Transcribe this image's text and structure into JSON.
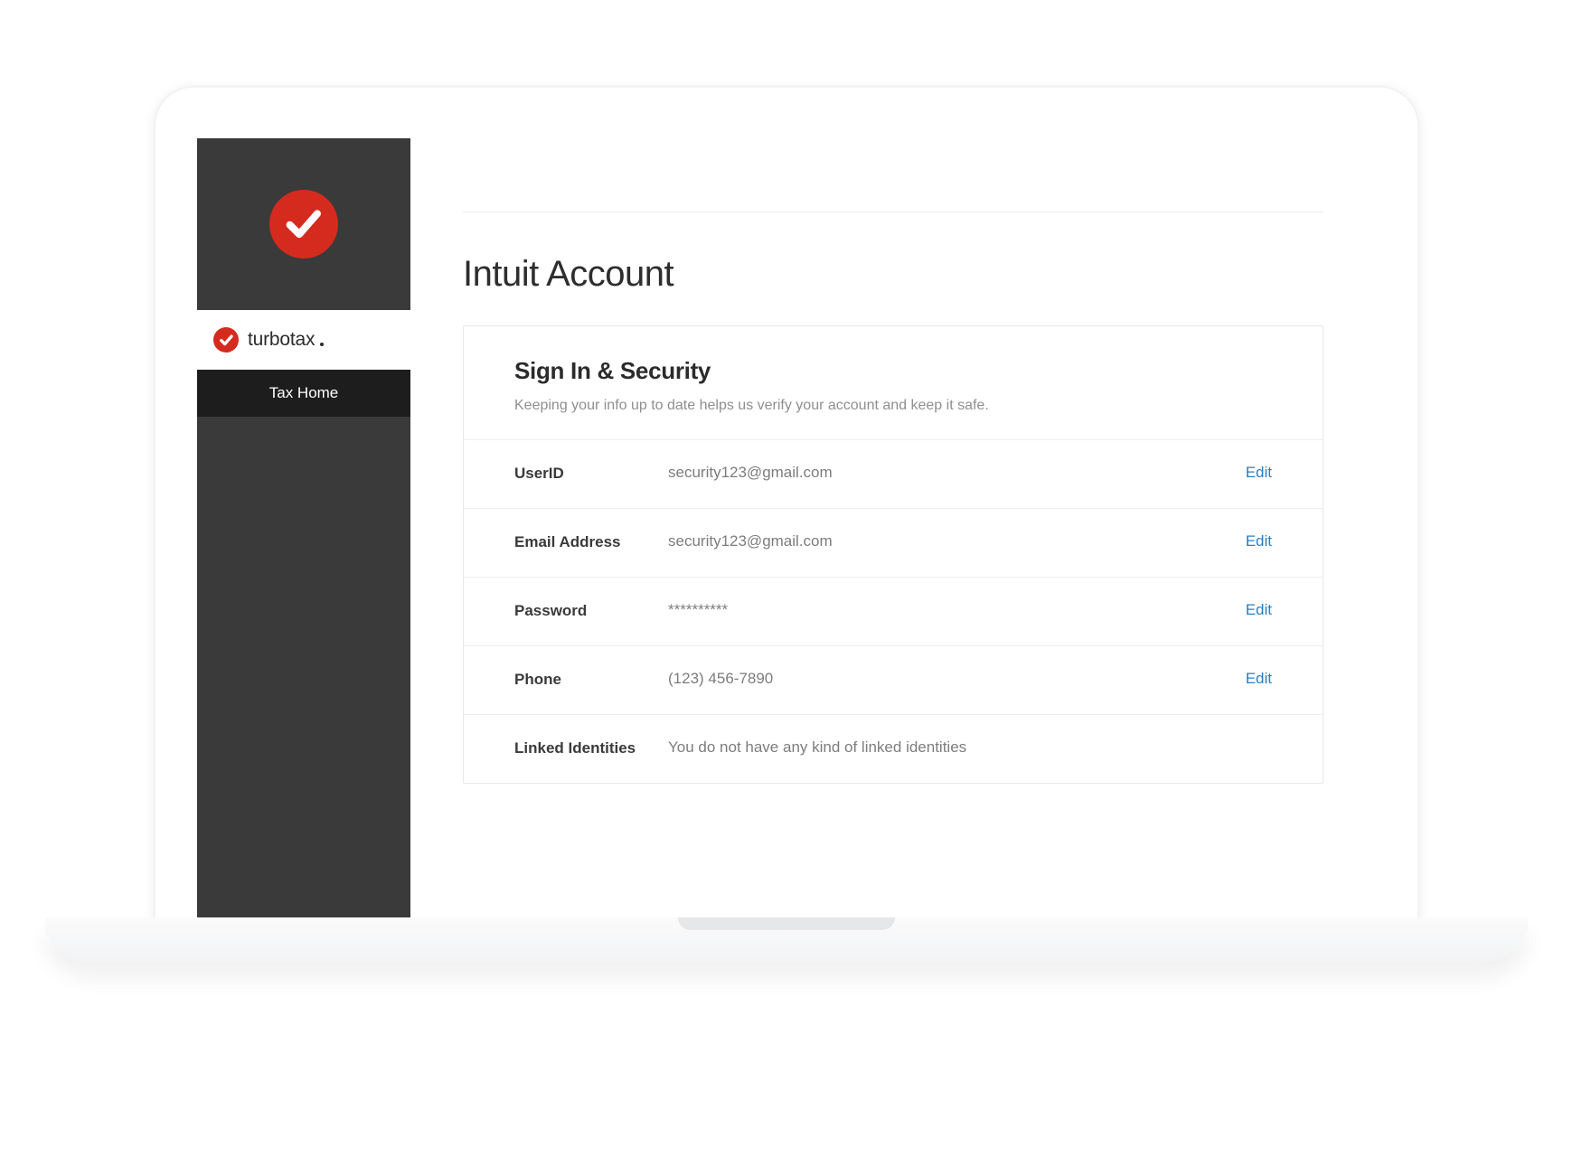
{
  "sidebar": {
    "brand_text": "turbotax",
    "nav": [
      {
        "label": "Tax Home"
      }
    ]
  },
  "page": {
    "title": "Intuit Account"
  },
  "card": {
    "title": "Sign In & Security",
    "subtitle": "Keeping your info up to date helps us verify your account and keep it safe.",
    "edit_label": "Edit",
    "rows": [
      {
        "label": "UserID",
        "value": "security123@gmail.com",
        "editable": true
      },
      {
        "label": "Email Address",
        "value": "security123@gmail.com",
        "editable": true
      },
      {
        "label": "Password",
        "value": "**********",
        "editable": true
      },
      {
        "label": "Phone",
        "value": "(123) 456-7890",
        "editable": true
      },
      {
        "label": "Linked Identities",
        "value": "You do not have any kind of linked identities",
        "editable": false
      }
    ]
  }
}
